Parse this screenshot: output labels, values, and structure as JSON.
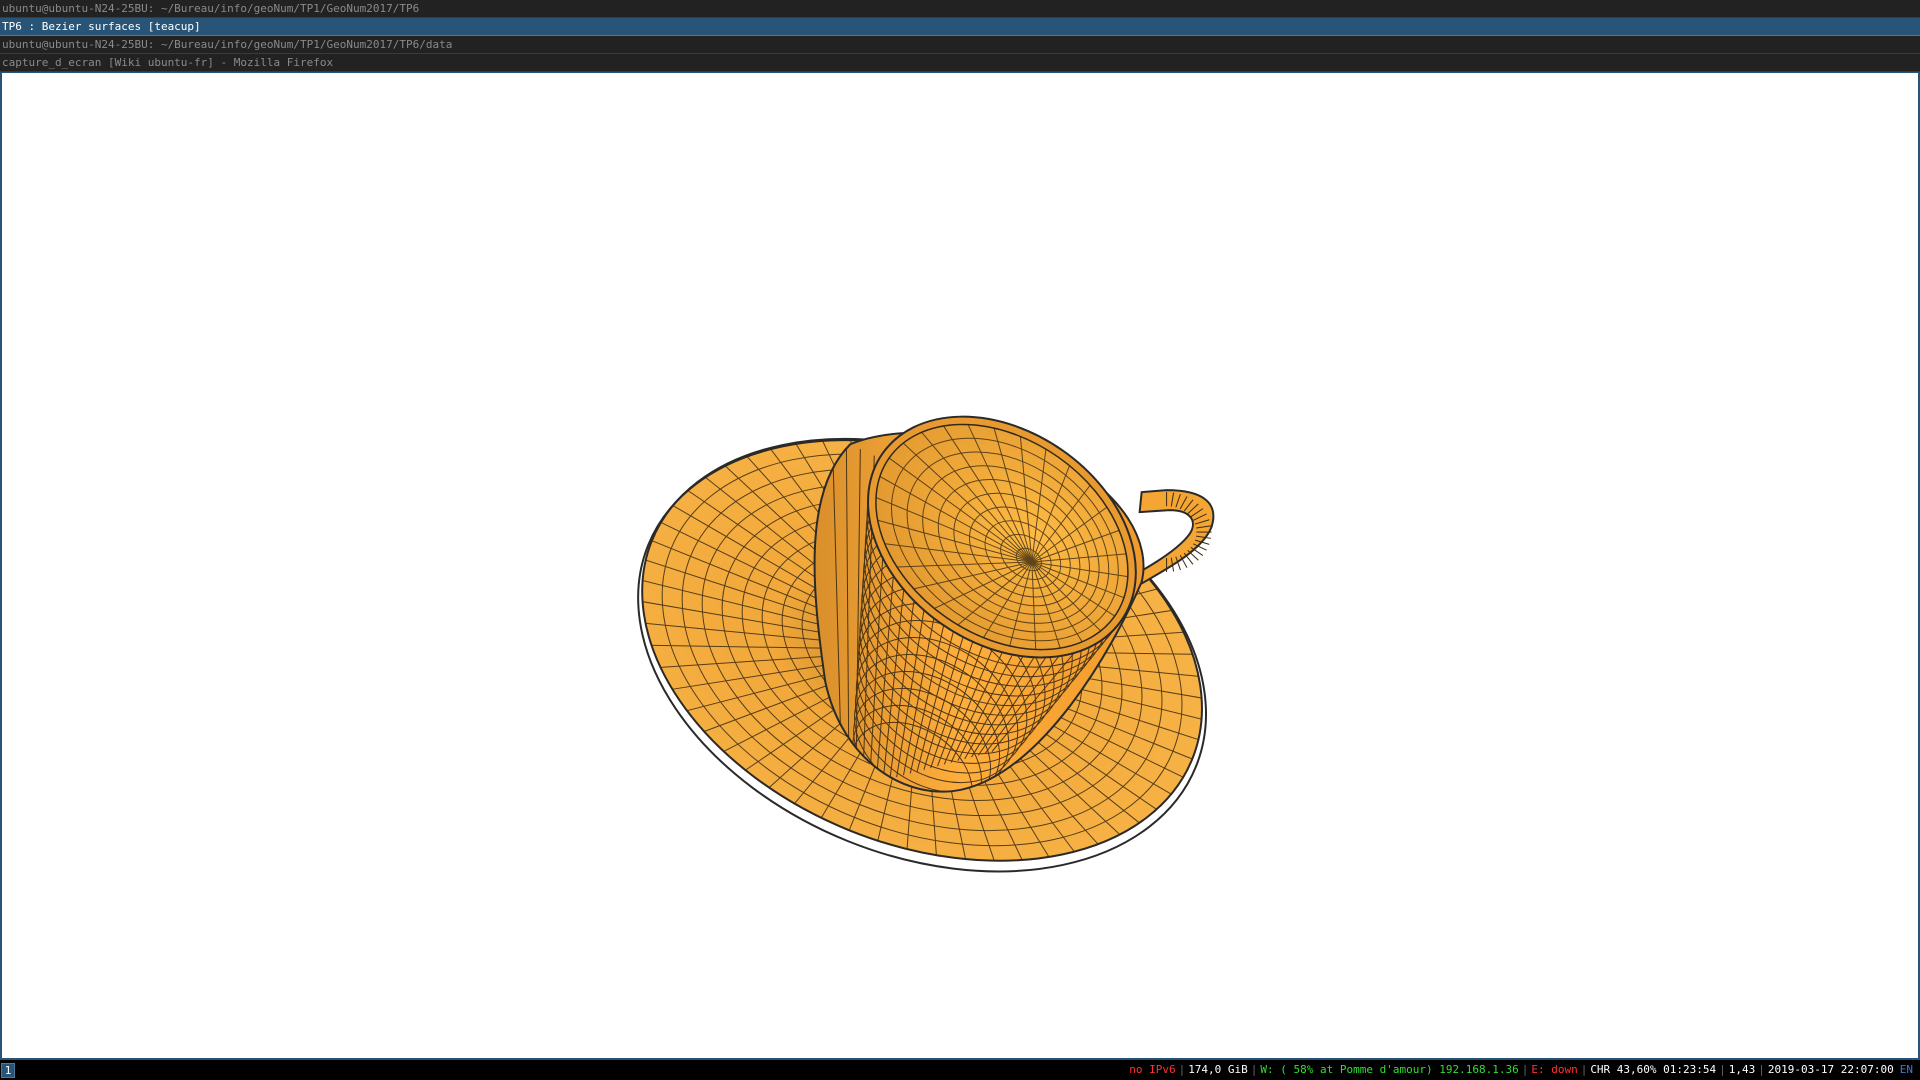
{
  "windows": {
    "titles": [
      "ubuntu@ubuntu-N24-25BU: ~/Bureau/info/geoNum/TP1/GeoNum2017/TP6",
      "TP6 : Bezier surfaces [teacup]",
      "ubuntu@ubuntu-N24-25BU: ~/Bureau/info/geoNum/TP1/GeoNum2017/TP6/data",
      "capture_d_ecran [Wiki ubuntu-fr] - Mozilla Firefox"
    ],
    "active_index": 1
  },
  "viewer": {
    "background": "#ffffff",
    "surface_color": "#f5a936",
    "wire_color": "#2a2a2a"
  },
  "statusbar": {
    "workspace": "1",
    "items": [
      {
        "text": "no IPv6",
        "color": "#ff3333"
      },
      {
        "text": "174,0 GiB",
        "color": "#ffffff"
      },
      {
        "text": "W: ( 58% at Pomme d'amour) 192.168.1.36",
        "color": "#33dd33"
      },
      {
        "text": "E: down",
        "color": "#ff3333"
      },
      {
        "text": "CHR 43,60% 01:23:54",
        "color": "#ffffff"
      },
      {
        "text": "1,43",
        "color": "#ffffff"
      },
      {
        "text": "2019-03-17 22:07:00",
        "color": "#ffffff"
      },
      {
        "text": "EN",
        "color": "#4a6fd8"
      }
    ]
  }
}
